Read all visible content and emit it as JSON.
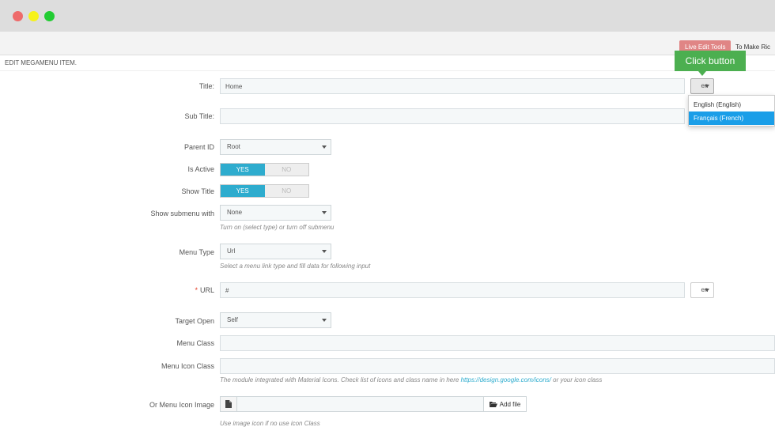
{
  "toolbar": {
    "live_edit_label": "Live Edit Tools",
    "note": "To Make Ric"
  },
  "panel": {
    "heading": "EDIT MEGAMENU ITEM."
  },
  "form": {
    "title": {
      "label": "Title:",
      "value": "Home",
      "lang": "en"
    },
    "sub_title": {
      "label": "Sub Title:",
      "value": ""
    },
    "parent_id": {
      "label": "Parent ID",
      "value": "Root"
    },
    "is_active": {
      "label": "Is Active",
      "yes": "YES",
      "no": "NO"
    },
    "show_title": {
      "label": "Show Title",
      "yes": "YES",
      "no": "NO"
    },
    "show_submenu": {
      "label": "Show submenu with",
      "value": "None",
      "help": "Turn on (select type) or turn off submenu"
    },
    "menu_type": {
      "label": "Menu Type",
      "value": "Url",
      "help": "Select a menu link type and fill data for following input"
    },
    "url": {
      "required_mark": "*",
      "label": "URL",
      "value": "#",
      "lang": "en"
    },
    "target_open": {
      "label": "Target Open",
      "value": "Self"
    },
    "menu_class": {
      "label": "Menu Class",
      "value": ""
    },
    "menu_icon_class": {
      "label": "Menu Icon Class",
      "value": "",
      "help_prefix": "The module integrated with Material Icons. Check list of icons and class name in here ",
      "help_link": "https://design.google.com/icons/",
      "help_suffix": " or your icon class"
    },
    "menu_icon_image": {
      "label": "Or Menu Icon Image",
      "button": "Add file",
      "help": "Use image icon if no use icon Class"
    }
  },
  "language_dropdown": {
    "options": [
      "English (English)",
      "Français (French)"
    ],
    "selected_index": 1
  },
  "callout": {
    "text": "Click button"
  },
  "colors": {
    "accent": "#2eacce",
    "live_edit": "#e08585",
    "callout": "#4caf50",
    "dropdown_selected": "#1a9ee8",
    "required": "#e4412a"
  }
}
